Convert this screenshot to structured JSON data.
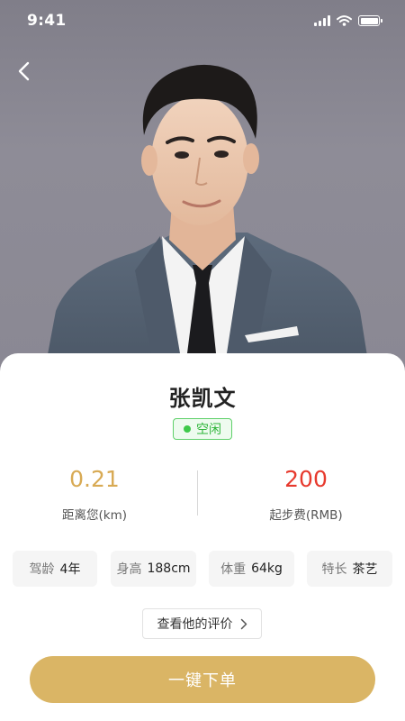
{
  "status_bar": {
    "time": "9:41"
  },
  "icons": {
    "back": "back-arrow-icon",
    "signal": "cellular-signal-icon",
    "wifi": "wifi-icon",
    "battery": "battery-icon",
    "chevron": "chevron-right-icon"
  },
  "driver": {
    "name": "张凯文",
    "status": "空闲",
    "status_color": "#2fb53a"
  },
  "stats": {
    "distance": {
      "value": "0.21",
      "label": "距离您(km)",
      "color": "#d8aa54"
    },
    "fee": {
      "value": "200",
      "label": "起步费(RMB)",
      "color": "#e73a2e"
    }
  },
  "attributes": [
    {
      "label": "驾龄",
      "value": "4年"
    },
    {
      "label": "身高",
      "value": "188cm"
    },
    {
      "label": "体重",
      "value": "64kg"
    },
    {
      "label": "特长",
      "value": "茶艺"
    }
  ],
  "reviews_link": "查看他的评价",
  "order_button": {
    "label": "一键下单",
    "color": "#dab565"
  }
}
